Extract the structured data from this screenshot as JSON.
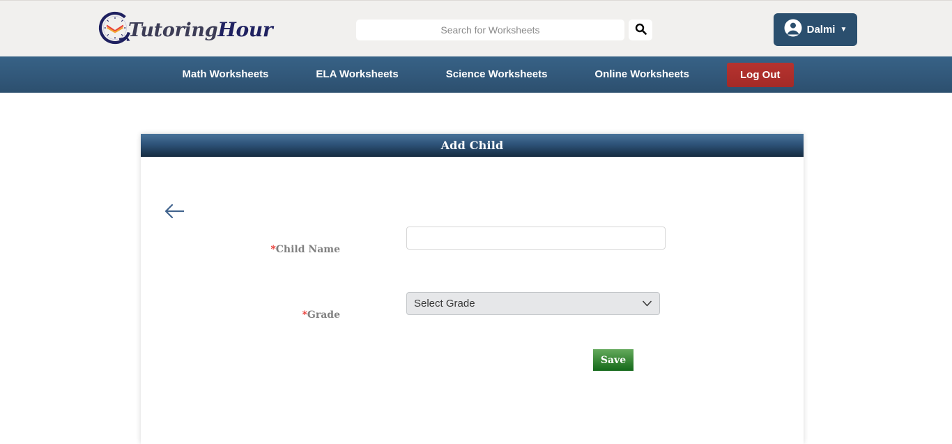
{
  "header": {
    "logo": {
      "icon": "clock-book-logo-icon",
      "word_main": "Tutoring",
      "word_accent": "Hour"
    },
    "search": {
      "placeholder": "Search for Worksheets",
      "value": "",
      "button_icon": "search-icon"
    },
    "account": {
      "icon": "user-circle-icon",
      "name": "Dalmi",
      "caret": "▼"
    }
  },
  "nav": {
    "items": [
      {
        "label": "Math Worksheets"
      },
      {
        "label": "ELA Worksheets"
      },
      {
        "label": "Science Worksheets"
      },
      {
        "label": "Online Worksheets"
      }
    ],
    "logout_label": "Log Out",
    "logout_color": "#a32a27"
  },
  "panel": {
    "title": "Add Child",
    "back_icon": "arrow-left-icon",
    "form": {
      "child_name": {
        "required_marker": "*",
        "label": "Child Name",
        "value": "",
        "placeholder": ""
      },
      "grade": {
        "required_marker": "*",
        "label": "Grade",
        "selected": "Select Grade",
        "options": [
          "Select Grade"
        ],
        "caret_icon": "chevron-down-icon"
      },
      "save_label": "Save",
      "save_color": "#14691a"
    }
  }
}
